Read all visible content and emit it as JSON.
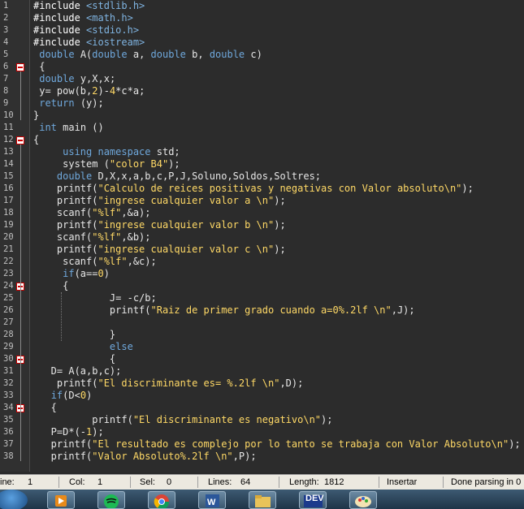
{
  "editor": {
    "lines": [
      {
        "n": "1",
        "tokens": [
          [
            "pre",
            "#include "
          ],
          [
            "inc",
            "<stdlib.h>"
          ]
        ]
      },
      {
        "n": "2",
        "tokens": [
          [
            "pre",
            "#include "
          ],
          [
            "inc",
            "<math.h>"
          ]
        ]
      },
      {
        "n": "3",
        "tokens": [
          [
            "pre",
            "#include "
          ],
          [
            "inc",
            "<stdio.h>"
          ]
        ]
      },
      {
        "n": "4",
        "tokens": [
          [
            "pre",
            "#include "
          ],
          [
            "inc",
            "<iostream>"
          ]
        ]
      },
      {
        "n": "5",
        "tokens": [
          [
            "id",
            " "
          ],
          [
            "type",
            "double"
          ],
          [
            "id",
            " A("
          ],
          [
            "type",
            "double"
          ],
          [
            "id",
            " a, "
          ],
          [
            "type",
            "double"
          ],
          [
            "id",
            " b, "
          ],
          [
            "type",
            "double"
          ],
          [
            "id",
            " c)"
          ]
        ]
      },
      {
        "n": "6",
        "fold": true,
        "tokens": [
          [
            "id",
            " {"
          ]
        ]
      },
      {
        "n": "7",
        "tokens": [
          [
            "id",
            " "
          ],
          [
            "type",
            "double"
          ],
          [
            "id",
            " y,X,x;"
          ]
        ]
      },
      {
        "n": "8",
        "tokens": [
          [
            "id",
            " y= pow(b,"
          ],
          [
            "num",
            "2"
          ],
          [
            "id",
            ")-"
          ],
          [
            "num",
            "4"
          ],
          [
            "id",
            "*c*a;"
          ]
        ]
      },
      {
        "n": "9",
        "tokens": [
          [
            "id",
            " "
          ],
          [
            "kw",
            "return"
          ],
          [
            "id",
            " (y);"
          ]
        ]
      },
      {
        "n": "10",
        "tokens": [
          [
            "id",
            "}"
          ]
        ]
      },
      {
        "n": "11",
        "tokens": [
          [
            "id",
            " "
          ],
          [
            "type",
            "int"
          ],
          [
            "id",
            " main ()"
          ]
        ]
      },
      {
        "n": "12",
        "fold": true,
        "tokens": [
          [
            "id",
            "{"
          ]
        ]
      },
      {
        "n": "13",
        "tokens": [
          [
            "id",
            "     "
          ],
          [
            "kw",
            "using"
          ],
          [
            "id",
            " "
          ],
          [
            "kw",
            "namespace"
          ],
          [
            "id",
            " std;"
          ]
        ]
      },
      {
        "n": "14",
        "tokens": [
          [
            "id",
            "     system ("
          ],
          [
            "str",
            "\"color B4\""
          ],
          [
            "id",
            ");"
          ]
        ]
      },
      {
        "n": "15",
        "tokens": [
          [
            "id",
            "    "
          ],
          [
            "type",
            "double"
          ],
          [
            "id",
            " D,X,x,a,b,c,P,J,Soluno,Soldos,Soltres;"
          ]
        ]
      },
      {
        "n": "16",
        "tokens": [
          [
            "id",
            "    printf("
          ],
          [
            "str",
            "\"Calculo de reices positivas y negativas con Valor absoluto\\n\""
          ],
          [
            "id",
            ");"
          ]
        ]
      },
      {
        "n": "17",
        "tokens": [
          [
            "id",
            "    printf("
          ],
          [
            "str",
            "\"ingrese cualquier valor a \\n\""
          ],
          [
            "id",
            ");"
          ]
        ]
      },
      {
        "n": "18",
        "tokens": [
          [
            "id",
            "    scanf("
          ],
          [
            "str",
            "\"%lf\""
          ],
          [
            "id",
            ",&a);"
          ]
        ]
      },
      {
        "n": "19",
        "tokens": [
          [
            "id",
            "    printf("
          ],
          [
            "str",
            "\"ingrese cualquier valor b \\n\""
          ],
          [
            "id",
            ");"
          ]
        ]
      },
      {
        "n": "20",
        "tokens": [
          [
            "id",
            "    scanf("
          ],
          [
            "str",
            "\"%lf\""
          ],
          [
            "id",
            ",&b);"
          ]
        ]
      },
      {
        "n": "21",
        "tokens": [
          [
            "id",
            "    printf("
          ],
          [
            "str",
            "\"ingrese cualquier valor c \\n\""
          ],
          [
            "id",
            ");"
          ]
        ]
      },
      {
        "n": "22",
        "tokens": [
          [
            "id",
            "     scanf("
          ],
          [
            "str",
            "\"%lf\""
          ],
          [
            "id",
            ",&c);"
          ]
        ]
      },
      {
        "n": "23",
        "tokens": [
          [
            "id",
            "     "
          ],
          [
            "kw",
            "if"
          ],
          [
            "id",
            "(a=="
          ],
          [
            "num",
            "0"
          ],
          [
            "id",
            ")"
          ]
        ]
      },
      {
        "n": "24",
        "fold": true,
        "tokens": [
          [
            "id",
            "     {"
          ]
        ]
      },
      {
        "n": "25",
        "tokens": [
          [
            "id",
            "             J= -c/b;"
          ]
        ]
      },
      {
        "n": "26",
        "tokens": [
          [
            "id",
            "             printf("
          ],
          [
            "str",
            "\"Raiz de primer grado cuando a=0%.2lf \\n\""
          ],
          [
            "id",
            ",J);"
          ]
        ]
      },
      {
        "n": "27",
        "tokens": [
          [
            "id",
            ""
          ]
        ]
      },
      {
        "n": "28",
        "tokens": [
          [
            "id",
            "             }"
          ]
        ]
      },
      {
        "n": "29",
        "tokens": [
          [
            "id",
            "             "
          ],
          [
            "kw",
            "else"
          ]
        ]
      },
      {
        "n": "30",
        "fold": true,
        "tokens": [
          [
            "id",
            "             {"
          ]
        ]
      },
      {
        "n": "31",
        "tokens": [
          [
            "id",
            "   D= A(a,b,c);"
          ]
        ]
      },
      {
        "n": "32",
        "tokens": [
          [
            "id",
            "    printf("
          ],
          [
            "str",
            "\"El discriminante es= %.2lf \\n\""
          ],
          [
            "id",
            ",D);"
          ]
        ]
      },
      {
        "n": "33",
        "tokens": [
          [
            "id",
            "   "
          ],
          [
            "kw",
            "if"
          ],
          [
            "id",
            "(D<"
          ],
          [
            "num",
            "0"
          ],
          [
            "id",
            ")"
          ]
        ]
      },
      {
        "n": "34",
        "fold": true,
        "tokens": [
          [
            "id",
            "   {"
          ]
        ]
      },
      {
        "n": "35",
        "tokens": [
          [
            "id",
            "          printf("
          ],
          [
            "str",
            "\"El discriminante es negativo\\n\""
          ],
          [
            "id",
            ");"
          ]
        ]
      },
      {
        "n": "36",
        "tokens": [
          [
            "id",
            "   P=D*(-"
          ],
          [
            "num",
            "1"
          ],
          [
            "id",
            ");"
          ]
        ]
      },
      {
        "n": "37",
        "tokens": [
          [
            "id",
            "   printf("
          ],
          [
            "str",
            "\"El resultado es complejo por lo tanto se trabaja con Valor Absoluto\\n\""
          ],
          [
            "id",
            ");"
          ]
        ]
      },
      {
        "n": "38",
        "tokens": [
          [
            "id",
            "   printf("
          ],
          [
            "str",
            "\"Valor Absoluto%.2lf \\n\""
          ],
          [
            "id",
            ",P);"
          ]
        ]
      }
    ]
  },
  "status": {
    "line_label": "ine:",
    "line_value": "1",
    "col_label": "Col:",
    "col_value": "1",
    "sel_label": "Sel:",
    "sel_value": "0",
    "lines_label": "Lines:",
    "lines_value": "64",
    "length_label": "Length:",
    "length_value": "1812",
    "mode": "Insertar",
    "parse_status": "Done parsing in 0"
  },
  "taskbar": {
    "dev_label": "DEV",
    "icons": [
      "start-orb-icon",
      "media-player-icon",
      "spotify-icon",
      "chrome-icon",
      "explorer-icon",
      "word-icon",
      "folder-icon",
      "devcpp-icon",
      "paint-icon"
    ]
  },
  "colors": {
    "background": "#2c2c2c",
    "keyword": "#6fa8dc",
    "string": "#ffd966",
    "text": "#e6e6e6"
  }
}
